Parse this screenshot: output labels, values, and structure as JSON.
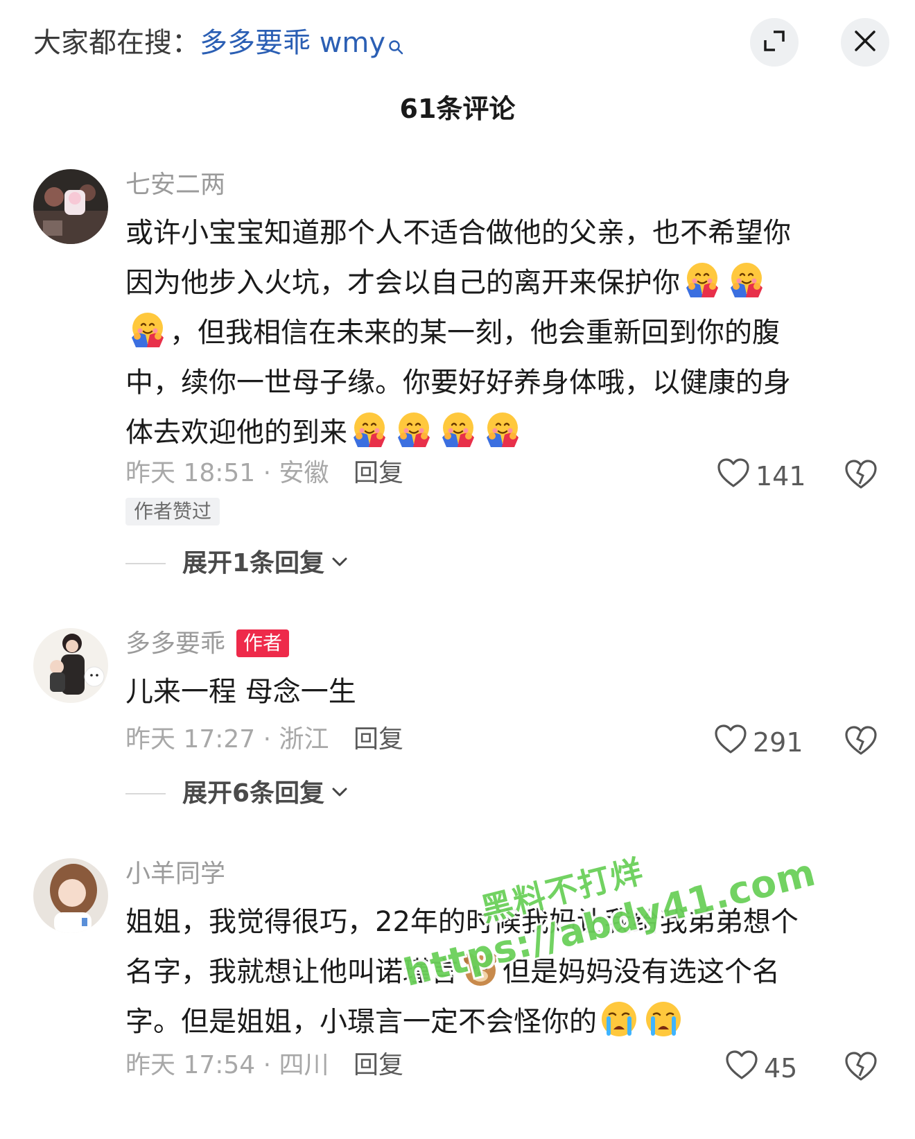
{
  "header": {
    "search_prefix": "大家都在搜：",
    "search_term": "多多要乖 wmy",
    "comment_count": "61条评论"
  },
  "comments": [
    {
      "username": "七安二两",
      "lines": [
        "或许小宝宝知道那个人不适合做他的父亲，也不希望你",
        "因为他步入火坑，才会以自己的离开来保护你",
        "，但我相信在未来的某一刻，他会重新回到你的腹",
        "中，续你一世母子缘。你要好好养身体哦，以健康的身",
        "体去欢迎他的到来"
      ],
      "time_location": "昨天 18:51 · 安徽",
      "reply_label": "回复",
      "likes": "141",
      "tag": "作者赞过",
      "expand_label": "展开1条回复"
    },
    {
      "username": "多多要乖",
      "badge": "作者",
      "text": "儿来一程 母念一生",
      "time_location": "昨天 17:27 · 浙江",
      "reply_label": "回复",
      "likes": "291",
      "expand_label": "展开6条回复"
    },
    {
      "username": "小羊同学",
      "lines": [
        "姐姐，我觉得很巧，22年的时候我妈让我给我弟弟想个",
        "名字，我就想让他叫诺瑾言",
        "但是妈妈没有选这个名",
        "字。但是姐姐，小璟言一定不会怪你的"
      ],
      "time_location": "昨天 17:54 · 四川",
      "reply_label": "回复",
      "likes": "45"
    }
  ],
  "watermark": {
    "line1": "黑料不打烊",
    "line2": "https://abdy41.com"
  },
  "icons": {
    "expand": "expand-icon",
    "close": "close-icon",
    "search": "search-icon",
    "like": "heart-outline-icon",
    "dislike": "broken-heart-icon",
    "hug": "hugging-face-emoji",
    "cry": "crying-face-emoji",
    "bear": "bear-face-emoji"
  }
}
